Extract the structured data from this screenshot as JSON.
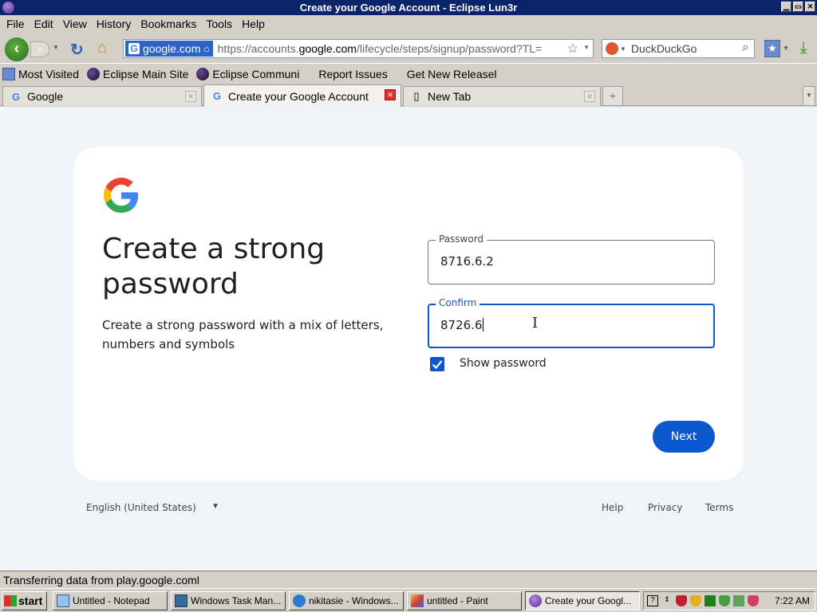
{
  "window": {
    "title": "Create your Google Account - Eclipse Lun3r",
    "btn_min": "▁",
    "btn_max": "▭",
    "btn_close": "✕"
  },
  "menu": [
    "File",
    "Edit",
    "View",
    "History",
    "Bookmarks",
    "Tools",
    "Help"
  ],
  "nav": {
    "site_identity": "google.com",
    "url_prefix": "https://accounts.",
    "url_domain": "google.com",
    "url_rest": "/lifecycle/steps/signup/password?TL=",
    "search_engine": "DuckDuckGo"
  },
  "bookmarks": [
    {
      "label": "Most Visited",
      "icon": "folder-icon"
    },
    {
      "label": "Eclipse Main Site",
      "icon": "eclipse-icon"
    },
    {
      "label": "Eclipse Communi",
      "icon": "eclipse-icon"
    },
    {
      "label": "Report Issues",
      "icon": ""
    },
    {
      "label": "Get New Releasel",
      "icon": ""
    }
  ],
  "tabs": [
    {
      "label": "Google",
      "active": false
    },
    {
      "label": "Create your Google Account",
      "active": true
    },
    {
      "label": "New Tab",
      "active": false
    }
  ],
  "page": {
    "heading": "Create a strong password",
    "subtext": "Create a strong password with a mix of letters, numbers and symbols",
    "password_label": "Password",
    "password_value": "8716.6.2",
    "confirm_label": "Confirm",
    "confirm_value": "8726.6",
    "show_password_label": "Show password",
    "show_password_checked": true,
    "next_label": "Next",
    "language": "English (United States)",
    "footer_links": [
      "Help",
      "Privacy",
      "Terms"
    ]
  },
  "status": "Transferring data from play.google.coml",
  "taskbar": {
    "start_label": "start",
    "tasks": [
      {
        "label": "Untitled - Notepad",
        "active": false
      },
      {
        "label": "Windows Task Man...",
        "active": false
      },
      {
        "label": "nikitasie - Windows...",
        "active": false
      },
      {
        "label": "untitled - Paint",
        "active": false
      },
      {
        "label": "Create your Googl...",
        "active": true
      }
    ],
    "clock": "7:22 AM"
  },
  "colors": {
    "accent": "#0b57d0",
    "page_bg": "#f0f4f9",
    "titlebar": "#0a246a"
  }
}
